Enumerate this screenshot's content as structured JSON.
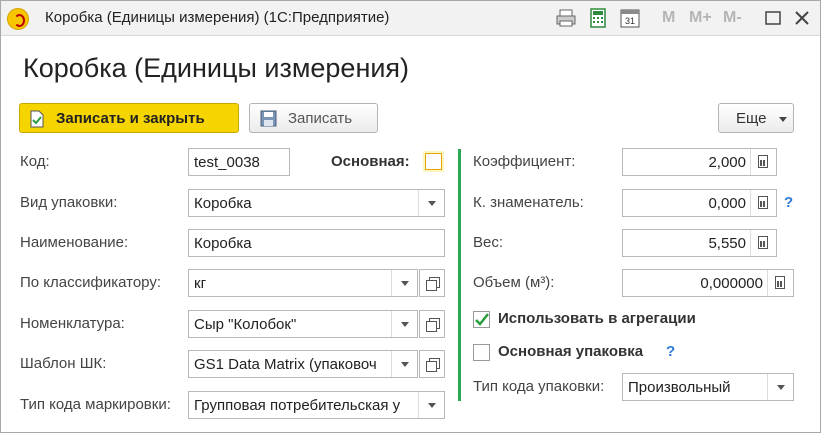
{
  "window": {
    "title": "Коробка (Единицы измерения)  (1С:Предприятие)"
  },
  "titlebar": {
    "m": "M",
    "m_plus": "M+",
    "m_minus": "M-"
  },
  "page_title": "Коробка (Единицы измерения)",
  "toolbar": {
    "save_close": "Записать и закрыть",
    "save": "Записать",
    "more": "Еще"
  },
  "fields": {
    "code": {
      "label": "Код:",
      "value": "test_0038"
    },
    "main": {
      "label": "Основная:"
    },
    "pack_type": {
      "label": "Вид упаковки:",
      "value": "Коробка"
    },
    "name": {
      "label": "Наименование:",
      "value": "Коробка"
    },
    "classifier": {
      "label": "По классификатору:",
      "value": "кг"
    },
    "nomenclature": {
      "label": "Номенклатура:",
      "value": "Сыр \"Колобок\""
    },
    "barcode_template": {
      "label": "Шаблон ШК:",
      "value": "GS1 Data Matrix (упаковоч"
    },
    "marking_code_type": {
      "label": "Тип кода маркировки:",
      "value": "Групповая потребительская у"
    },
    "coefficient": {
      "label": "Коэффициент:",
      "value": "2,000"
    },
    "denominator": {
      "label": "К. знаменатель:",
      "value": "0,000",
      "help": "?"
    },
    "weight": {
      "label": "Вес:",
      "value": "5,550"
    },
    "volume": {
      "label": "Объем (м³):",
      "value": "0,000000"
    },
    "use_aggregation": {
      "label": "Использовать в агрегации",
      "checked": true
    },
    "main_pack": {
      "label": "Основная упаковка",
      "checked": false,
      "help": "?"
    },
    "pack_code_type": {
      "label": "Тип кода упаковки:",
      "value": "Произвольный"
    }
  },
  "colors": {
    "accent_yellow": "#f5d400",
    "divider_green": "#2aa853",
    "help_blue": "#2c7bd6",
    "check_green": "#2a9d3c"
  }
}
